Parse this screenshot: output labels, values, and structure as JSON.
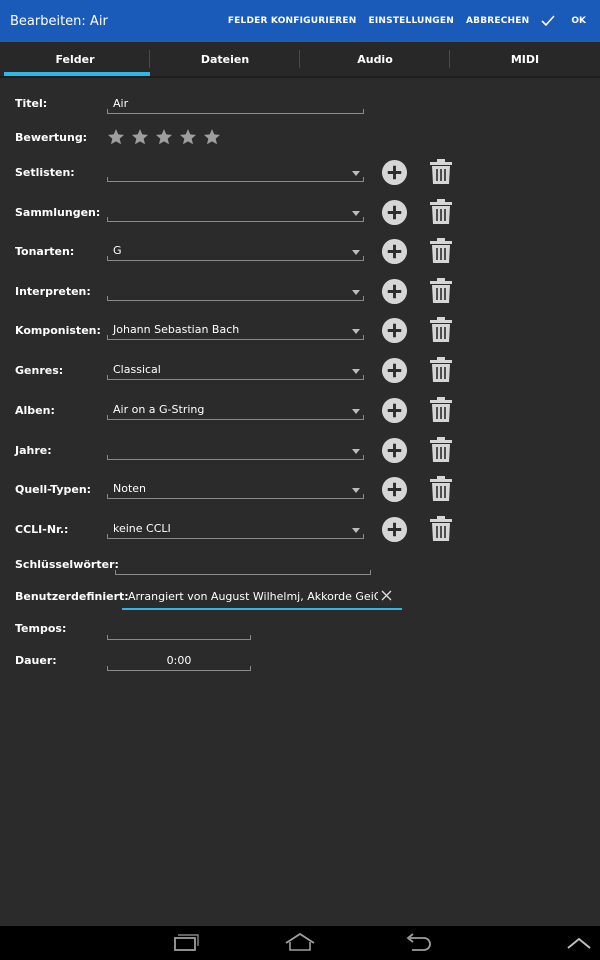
{
  "actionbar": {
    "title": "Bearbeiten: Air",
    "configure": "FELDER KONFIGURIEREN",
    "settings": "EINSTELLUNGEN",
    "cancel": "ABBRECHEN",
    "ok": "OK"
  },
  "tabs": [
    "Felder",
    "Dateien",
    "Audio",
    "MIDI"
  ],
  "fields": {
    "title_label": "Titel:",
    "title_value": "Air",
    "rating_label": "Bewertung:",
    "rating_stars": 0,
    "rating_max": 5,
    "setlists_label": "Setlisten:",
    "setlists_value": "",
    "collections_label": "Sammlungen:",
    "collections_value": "",
    "keys_label": "Tonarten:",
    "keys_value": "G",
    "artists_label": "Interpreten:",
    "artists_value": "",
    "composers_label": "Komponisten:",
    "composers_value": "Johann Sebastian Bach",
    "genres_label": "Genres:",
    "genres_value": "Classical",
    "albums_label": "Alben:",
    "albums_value": "Air on a G-String",
    "years_label": "Jahre:",
    "years_value": "",
    "source_label": "Quell-Typen:",
    "source_value": "Noten",
    "ccli_label": "CCLI-Nr.:",
    "ccli_value": "keine CCLI",
    "keywords_label": "Schlüsselwörter:",
    "keywords_value": "",
    "custom_label": "Benutzerdefiniert:",
    "custom_value": "Arrangiert von August Wilhelmj, Akkorde GeiGit",
    "tempos_label": "Tempos:",
    "tempos_value": "",
    "duration_label": "Dauer:",
    "duration_value": "0:00"
  },
  "icons": {
    "add": "plus-circle-icon",
    "delete": "trash-icon",
    "star": "star-icon",
    "check": "check-icon",
    "clear": "close-icon",
    "recent": "recent-apps-icon",
    "home": "home-icon",
    "back": "back-icon",
    "up": "chevron-up-icon"
  },
  "colors": {
    "actionbar": "#1a5ab8",
    "accent": "#33b5e5",
    "background": "#2b2b2b"
  }
}
